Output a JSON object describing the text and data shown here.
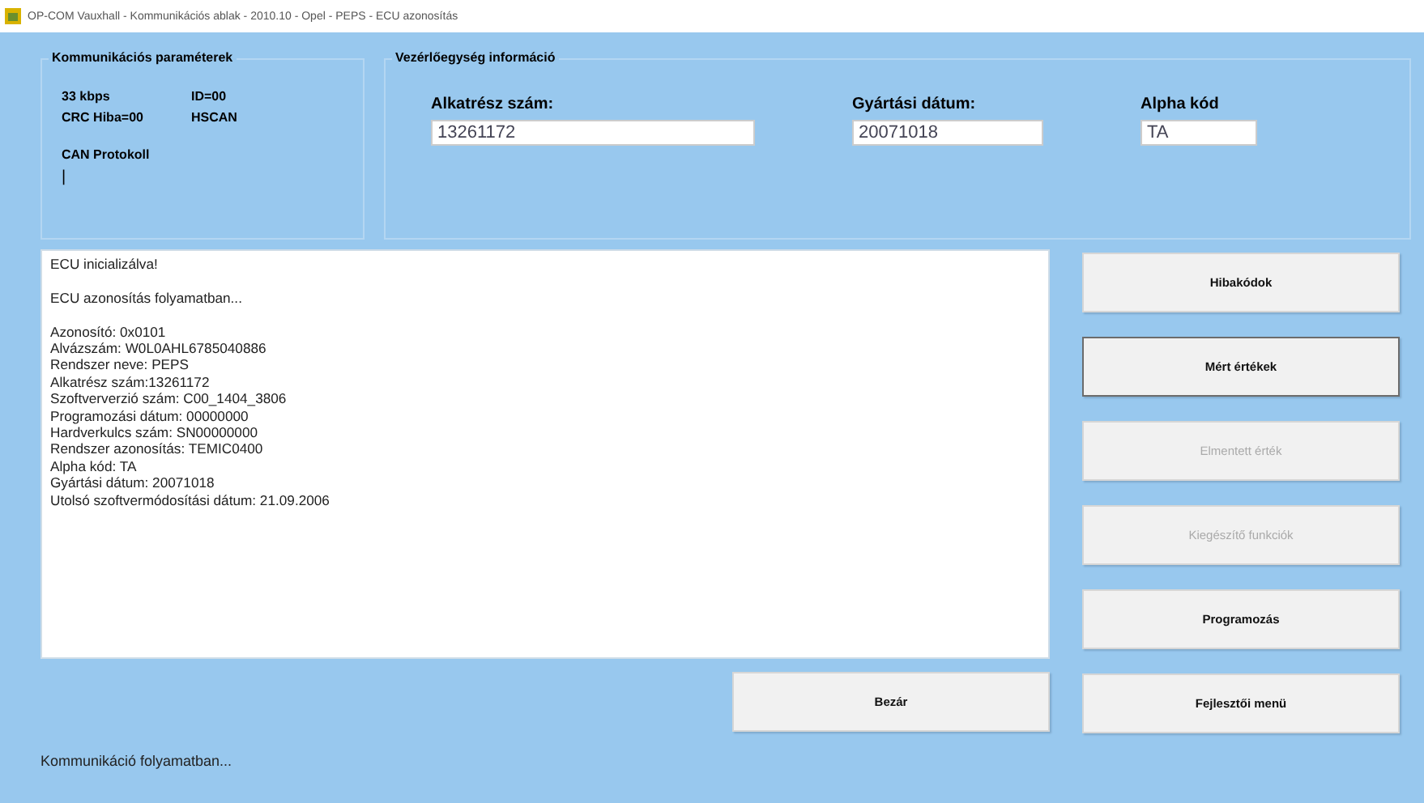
{
  "window": {
    "title": "OP-COM Vauxhall - Kommunikációs ablak - 2010.10 - Opel - PEPS - ECU azonosítás"
  },
  "communication": {
    "title": "Kommunikációs paraméterek",
    "params": [
      {
        "label": "33 kbps"
      },
      {
        "label": "ID=00"
      },
      {
        "label": "CRC Hiba=00"
      },
      {
        "label": "HSCAN"
      }
    ],
    "protocol_label": "CAN Protokoll",
    "protocol_value": "|"
  },
  "ecu_info": {
    "title": "Vezérlőegység információ",
    "fields": [
      {
        "label": "Alkatrész szám:",
        "value": "13261172"
      },
      {
        "label": "Gyártási dátum:",
        "value": "20071018"
      },
      {
        "label": "Alpha kód",
        "value": "TA"
      }
    ]
  },
  "log": {
    "blocks": [
      {
        "lines": [
          "ECU inicializálva!"
        ]
      },
      {
        "lines": [
          "ECU azonosítás folyamatban..."
        ]
      },
      {
        "lines": [
          "Azonosító: 0x0101",
          "Alvázszám: W0L0AHL6785040886",
          "Rendszer neve: PEPS",
          "Alkatrész szám:13261172",
          "Szoftververzió szám: C00_1404_3806",
          "Programozási dátum: 00000000",
          "Hardverkulcs szám: SN00000000",
          "Rendszer azonosítás: TEMIC0400",
          "Alpha kód: TA",
          "Gyártási dátum: 20071018",
          "Utolsó szoftvermódosítási dátum: 21.09.2006"
        ]
      }
    ]
  },
  "side_buttons": [
    {
      "label": "Hibakódok",
      "disabled": false,
      "focused": false
    },
    {
      "label": "Mért értékek",
      "disabled": false,
      "focused": true
    },
    {
      "label": "Elmentett érték",
      "disabled": true,
      "focused": false
    },
    {
      "label": "Kiegészítő funkciók",
      "disabled": true,
      "focused": false
    },
    {
      "label": "Programozás",
      "disabled": false,
      "focused": false
    }
  ],
  "close_button": {
    "label": "Bezár"
  },
  "dev_button": {
    "label": "Fejlesztői menü"
  },
  "status_bar": {
    "text": "Kommunikáció folyamatban..."
  }
}
